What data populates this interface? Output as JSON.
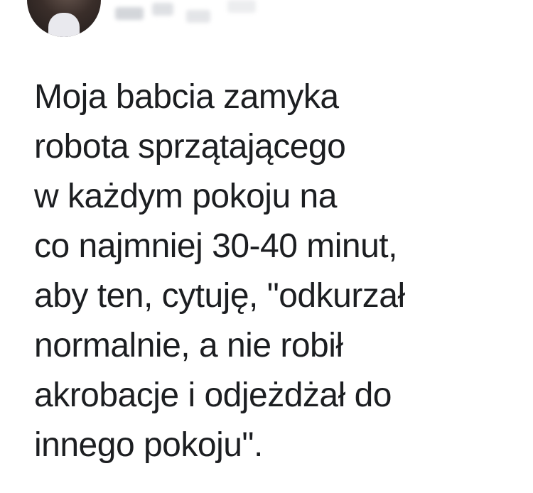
{
  "post": {
    "lines": [
      "Moja babcia zamyka",
      "robota sprzątającego",
      "w każdym pokoju na",
      "co najmniej 30-40 minut,",
      "aby ten, cytuję, \"odkurzał",
      "normalnie, a nie robił",
      "akrobacje i odjeżdżał do",
      "innego pokoju\"."
    ]
  },
  "colors": {
    "text": "#1c1e21",
    "background": "#ffffff"
  }
}
